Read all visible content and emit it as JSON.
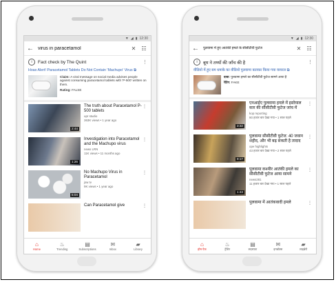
{
  "status": {
    "time": "12:30"
  },
  "left": {
    "search_query": "virus in paracetamol",
    "factcheck": {
      "header": "Fact check by The Quint",
      "link": "Hoax Alert! Paracetamol Tablets Do Not Contain 'Machupo' Virus",
      "claim_label": "Claim:",
      "claim_text": "A viral message on social media advises people against consuming paracetamol tablets with 'P-500' written on them.",
      "rating_label": "Rating:",
      "rating_value": "FALSE"
    },
    "videos": [
      {
        "title": "The truth about Paracetamol P-500 tablets",
        "channel": "upr studio",
        "stats": "363K views • 1 year ago",
        "duration": "2:44"
      },
      {
        "title": "Investigation into Paracetamol and the Machupo virus",
        "channel": "news LRN",
        "stats": "11K views • 11 months ago",
        "duration": "1:26"
      },
      {
        "title": "No Machupo Virus in Paracetamol",
        "channel": "jsw tv",
        "stats": "9K views • 1 year ago",
        "duration": "5:04"
      },
      {
        "title": "Can Paracetamol give",
        "channel": "",
        "stats": "",
        "duration": ""
      }
    ],
    "nav": [
      "Home",
      "Trending",
      "Subscriptions",
      "Inbox",
      "Library"
    ]
  },
  "right": {
    "search_query": "पुलवामा में हुए आतंकी हमले के सीसीटीवी फुटेज",
    "factcheck": {
      "header": "बूम ने तथ्यों की जाँच की है",
      "link": "वीडियो में हुए बम धमाके का वीडियो पुलवामा बताकर किया गया वायरल",
      "claim_label": "दावा:",
      "claim_text": "पुलवामा हमले का सीसीटीवी फुटेज सामने आया है",
      "rating_label": "रेटिंग:",
      "rating_value": "FAKE"
    },
    "videos": [
      {
        "title": "एनआईए पुलवामा हमले में इस्तेमाल कार की सीसीटीवी फुटेज जांच में",
        "channel": "kop reporting",
        "stats": "90 हजार बार देखा गया • 1 साल पहले",
        "duration": "3:32"
      },
      {
        "title": "पुलवामा सीसीटीवी फुटेज: 40 जवान शहीद, और भी बढ़ सकती है तादाद",
        "channel": "ope highlights",
        "stats": "43 हजार बार देखा गया • 2 साल पहले",
        "duration": "9:17"
      },
      {
        "title": "पुलवामा कश्मीर आतंकी हमले का सीसीटीवी फुटेज आया सामने",
        "channel": "news281",
        "stats": "11 हजार बार देखा गया • 1 साल पहले",
        "duration": "1:43"
      },
      {
        "title": "पुलवामा में आतंकवादी हमले",
        "channel": "",
        "stats": "",
        "duration": ""
      }
    ],
    "nav": [
      "होम पेज",
      "ट्रेंडिंग",
      "सदस्यता",
      "इनबॉक्स",
      "लाइब्रेरी"
    ]
  }
}
